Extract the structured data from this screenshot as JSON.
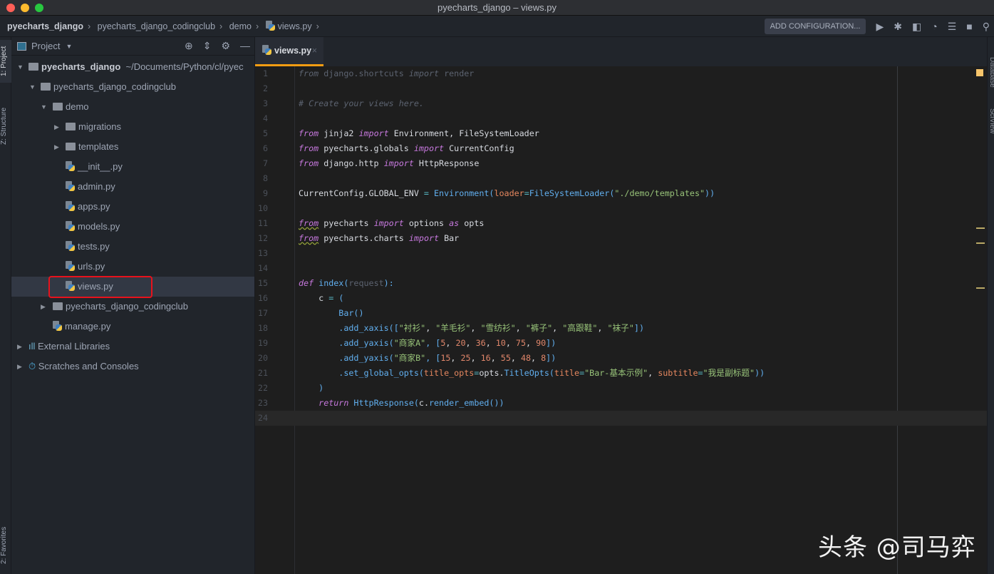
{
  "window": {
    "title": "pyecharts_django – views.py"
  },
  "breadcrumb": [
    "pyecharts_django",
    "pyecharts_django_codingclub",
    "demo",
    "views.py"
  ],
  "toolbar": {
    "add_configuration": "ADD CONFIGURATION...",
    "icons": [
      "run-icon",
      "debug-icon",
      "coverage-icon",
      "profile-icon",
      "run-concurrency-icon",
      "stop-icon",
      "search-icon"
    ]
  },
  "left_strip": {
    "project": "1: Project",
    "structure": "Z: Structure",
    "favorites": "2: Favorites"
  },
  "right_strip": {
    "database": "Database",
    "sciview": "SciView"
  },
  "project_panel": {
    "title": "Project",
    "tree": [
      {
        "label": "pyecharts_django",
        "suffix": "~/Documents/Python/cl/pyec",
        "type": "folder",
        "level": 0,
        "expanded": true
      },
      {
        "label": "pyecharts_django_codingclub",
        "type": "folder",
        "level": 1,
        "expanded": true
      },
      {
        "label": "demo",
        "type": "folder",
        "level": 2,
        "expanded": true
      },
      {
        "label": "migrations",
        "type": "folder",
        "level": 3,
        "expanded": false
      },
      {
        "label": "templates",
        "type": "folder",
        "level": 3,
        "expanded": false
      },
      {
        "label": "__init__.py",
        "type": "py",
        "level": 3
      },
      {
        "label": "admin.py",
        "type": "py",
        "level": 3
      },
      {
        "label": "apps.py",
        "type": "py",
        "level": 3
      },
      {
        "label": "models.py",
        "type": "py",
        "level": 3
      },
      {
        "label": "tests.py",
        "type": "py",
        "level": 3
      },
      {
        "label": "urls.py",
        "type": "py",
        "level": 3
      },
      {
        "label": "views.py",
        "type": "py",
        "level": 3,
        "selected": true
      },
      {
        "label": "pyecharts_django_codingclub",
        "type": "folder",
        "level": 2,
        "expanded": false
      },
      {
        "label": "manage.py",
        "type": "py",
        "level": 2
      },
      {
        "label": "External Libraries",
        "type": "lib",
        "level": 0,
        "expanded": false
      },
      {
        "label": "Scratches and Consoles",
        "type": "scratch",
        "level": 0,
        "expanded": false
      }
    ]
  },
  "editor": {
    "tab": "views.py",
    "current_line": 24,
    "lines": [
      [
        [
          "from",
          "ui"
        ],
        [
          " django.shortcuts ",
          "u"
        ],
        [
          "import",
          "ui"
        ],
        [
          " render",
          "u"
        ]
      ],
      [],
      [
        [
          "# Create your views here.",
          "c"
        ]
      ],
      [],
      [
        [
          "from",
          "k"
        ],
        [
          " jinja2 ",
          "d"
        ],
        [
          "import",
          "k"
        ],
        [
          " Environment, FileSystemLoader",
          "d"
        ]
      ],
      [
        [
          "from",
          "k"
        ],
        [
          " pyecharts.globals ",
          "d"
        ],
        [
          "import",
          "k"
        ],
        [
          " CurrentConfig",
          "d"
        ]
      ],
      [
        [
          "from",
          "k"
        ],
        [
          " django.http ",
          "d"
        ],
        [
          "import",
          "k"
        ],
        [
          " HttpResponse",
          "d"
        ]
      ],
      [],
      [
        [
          "CurrentConfig.GLOBAL_ENV ",
          "d"
        ],
        [
          "=",
          "o"
        ],
        [
          " Environment(",
          "f"
        ],
        [
          "loader",
          "p"
        ],
        [
          "=",
          "o"
        ],
        [
          "FileSystemLoader(",
          "f"
        ],
        [
          "\"./demo/templates\"",
          "s"
        ],
        [
          "))",
          "f"
        ]
      ],
      [],
      [
        [
          "from",
          "w"
        ],
        [
          " pyecharts ",
          "d"
        ],
        [
          "import",
          "k"
        ],
        [
          " options ",
          "d"
        ],
        [
          "as",
          "k"
        ],
        [
          " opts",
          "d"
        ]
      ],
      [
        [
          "from",
          "w"
        ],
        [
          " pyecharts.charts ",
          "d"
        ],
        [
          "import",
          "k"
        ],
        [
          " Bar",
          "d"
        ]
      ],
      [],
      [],
      [
        [
          "def",
          "k"
        ],
        [
          " index(",
          "f"
        ],
        [
          "request",
          "u"
        ],
        [
          "):",
          "f"
        ]
      ],
      [
        [
          "    c ",
          "d"
        ],
        [
          "=",
          "o"
        ],
        [
          " (",
          "f"
        ]
      ],
      [
        [
          "        Bar()",
          "f"
        ]
      ],
      [
        [
          "        .add_xaxis([",
          "f"
        ],
        [
          "\"衬衫\"",
          "s"
        ],
        [
          ", ",
          "d"
        ],
        [
          "\"羊毛衫\"",
          "s"
        ],
        [
          ", ",
          "d"
        ],
        [
          "\"雪纺衫\"",
          "s"
        ],
        [
          ", ",
          "d"
        ],
        [
          "\"裤子\"",
          "s"
        ],
        [
          ", ",
          "d"
        ],
        [
          "\"高跟鞋\"",
          "s"
        ],
        [
          ", ",
          "d"
        ],
        [
          "\"袜子\"",
          "s"
        ],
        [
          "])",
          "f"
        ]
      ],
      [
        [
          "        .add_yaxis(",
          "f"
        ],
        [
          "\"商家A\"",
          "s"
        ],
        [
          ", [",
          "f"
        ],
        [
          "5",
          "n"
        ],
        [
          ", ",
          "d"
        ],
        [
          "20",
          "n"
        ],
        [
          ", ",
          "d"
        ],
        [
          "36",
          "n"
        ],
        [
          ", ",
          "d"
        ],
        [
          "10",
          "n"
        ],
        [
          ", ",
          "d"
        ],
        [
          "75",
          "n"
        ],
        [
          ", ",
          "d"
        ],
        [
          "90",
          "n"
        ],
        [
          "])",
          "f"
        ]
      ],
      [
        [
          "        .add_yaxis(",
          "f"
        ],
        [
          "\"商家B\"",
          "s"
        ],
        [
          ", [",
          "f"
        ],
        [
          "15",
          "n"
        ],
        [
          ", ",
          "d"
        ],
        [
          "25",
          "n"
        ],
        [
          ", ",
          "d"
        ],
        [
          "16",
          "n"
        ],
        [
          ", ",
          "d"
        ],
        [
          "55",
          "n"
        ],
        [
          ", ",
          "d"
        ],
        [
          "48",
          "n"
        ],
        [
          ", ",
          "d"
        ],
        [
          "8",
          "n"
        ],
        [
          "])",
          "f"
        ]
      ],
      [
        [
          "        .set_global_opts(",
          "f"
        ],
        [
          "title_opts",
          "p"
        ],
        [
          "=",
          "o"
        ],
        [
          "opts.",
          "d"
        ],
        [
          "TitleOpts(",
          "f"
        ],
        [
          "title",
          "p"
        ],
        [
          "=",
          "o"
        ],
        [
          "\"Bar-基本示例\"",
          "s"
        ],
        [
          ", ",
          "d"
        ],
        [
          "subtitle",
          "p"
        ],
        [
          "=",
          "o"
        ],
        [
          "\"我是副标题\"",
          "s"
        ],
        [
          "))",
          "f"
        ]
      ],
      [
        [
          "    )",
          "f"
        ]
      ],
      [
        [
          "    ",
          "d"
        ],
        [
          "return",
          "k"
        ],
        [
          " HttpResponse(",
          "f"
        ],
        [
          "c.",
          "d"
        ],
        [
          "render_embed())",
          "f"
        ]
      ],
      []
    ]
  },
  "watermark": "头条 @司马弈"
}
